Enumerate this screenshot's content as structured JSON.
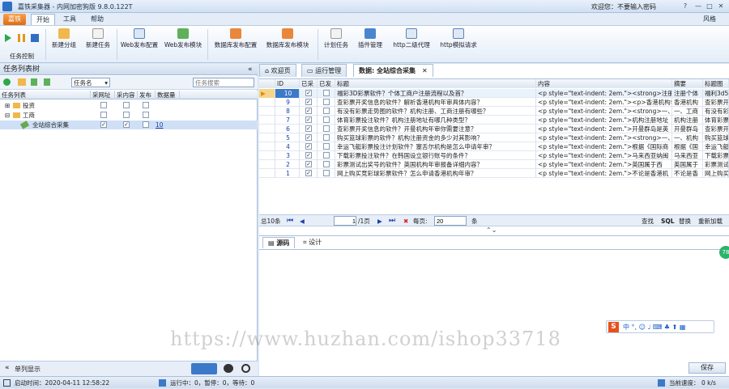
{
  "titlebar": {
    "title": "嘉铁采集器 - 内网加密狗版 9.8.0.122T",
    "welcome": "欢迎您：不要输入密码"
  },
  "menu": {
    "app": "嘉铁",
    "tabs": [
      "开始",
      "工具",
      "帮助"
    ],
    "right": "风格"
  },
  "ribbon": {
    "group_label": "任务控制",
    "buttons": [
      "新建分组",
      "新建任务",
      "Web发布配置",
      "Web发布模块",
      "数据库发布配置",
      "数据库发布模块",
      "计划任务",
      "插件管理",
      "http二级代理",
      "http模拟请求"
    ]
  },
  "left": {
    "title": "任务列表树",
    "filter_select": "任务名",
    "search_placeholder": "任务搜索",
    "columns": [
      "任务列表",
      "采网址",
      "采内容",
      "发布",
      "数据量"
    ],
    "tree": [
      {
        "name": "投资",
        "url": false,
        "content": false,
        "publish": false,
        "count": ""
      },
      {
        "name": "工商",
        "url": false,
        "content": false,
        "publish": false,
        "count": ""
      },
      {
        "name": "全站综合采集",
        "url": true,
        "content": true,
        "publish": false,
        "count": "10"
      }
    ],
    "bottom_label": "单列显示"
  },
  "right": {
    "tabs": [
      "欢迎页",
      "运行管理",
      "数据: 全站综合采集"
    ],
    "columns": [
      "ID",
      "已采",
      "已发",
      "标题",
      "内容",
      "摘要",
      "标题图"
    ],
    "rows": [
      {
        "id": "10",
        "c": true,
        "p": false,
        "title": "福彩3D彩票软件？个体工商户注册流程以及首？",
        "content": "<p style=\"text-indent: 2em.\"><strong>注册",
        "abs": "注册个体",
        "pic": "福利3d56"
      },
      {
        "id": "9",
        "c": true,
        "p": false,
        "title": "查彩票开奖信息的软件？解析香港机构年审具体内容？",
        "content": "<p style=\"text-indent: 2em.\"><p>香港机构年",
        "abs": "香港机构",
        "pic": "查彩票开"
      },
      {
        "id": "8",
        "c": true,
        "p": false,
        "title": "有没有彩票走势图的软件？机构注册、工商注册有哪些？",
        "content": "<p style=\"text-indent: 2em.\"><strong>一、工商",
        "abs": "一、工商",
        "pic": "有没有彩"
      },
      {
        "id": "7",
        "c": true,
        "p": false,
        "title": "体育彩票投注软件？机构注册地址有哪几种类型？",
        "content": "<p style=\"text-indent: 2em.\">机构注册地址",
        "abs": "机构注册",
        "pic": "体育彩票"
      },
      {
        "id": "6",
        "c": true,
        "p": false,
        "title": "查彩票开奖信息的软件？开曼机构年审你需要注意？",
        "content": "<p style=\"text-indent: 2em.\">开曼群岛是英",
        "abs": "开曼群岛",
        "pic": "查彩票开"
      },
      {
        "id": "5",
        "c": true,
        "p": false,
        "title": "购买篮球彩票的软件？机构注册资金的多少对其影响？",
        "content": "<p style=\"text-indent: 2em.\"><strong>一、",
        "abs": "一、机构",
        "pic": "购买篮球"
      },
      {
        "id": "4",
        "c": true,
        "p": false,
        "title": "幸运飞艇彩票投注计划软件？塞舌尔机构是怎么申请年审？",
        "content": "<p style=\"text-indent: 2em.\">根据《国际商",
        "abs": "根据《国",
        "pic": "幸运飞艇"
      },
      {
        "id": "3",
        "c": true,
        "p": false,
        "title": "下载彩票投注软件？在韩国设立银行账号的条件？",
        "content": "<p style=\"text-indent: 2em.\">马来西亚纳闽",
        "abs": "马来西亚",
        "pic": "下载彩票"
      },
      {
        "id": "2",
        "c": true,
        "p": false,
        "title": "彩票测试出奖号的软件？英国机构年审报备详细内容？",
        "content": "<p style=\"text-indent: 2em.\">英国属于西",
        "abs": "英国属于",
        "pic": "彩票测试"
      },
      {
        "id": "1",
        "c": true,
        "p": false,
        "title": "网上购买竞彩球彩票软件？怎么申请香港机构年审？",
        "content": "<p style=\"text-indent: 2em.\">不论是香港机",
        "abs": "不论是香",
        "pic": "网上购买"
      }
    ],
    "pager": {
      "total": "总10条",
      "page_value": "1",
      "page_suffix": "/1页",
      "per_page_label": "每页:",
      "per_page": "20",
      "unit": "条",
      "actions": [
        "查找",
        "SQL",
        "替换",
        "重新加载"
      ]
    },
    "subtabs": [
      "源码",
      "设计"
    ],
    "save": "保存"
  },
  "watermark": "https://www.huzhan.com/ishop33718",
  "status": {
    "start": "启动时间：2020-04-11 12:58:22",
    "run": "运行中：0，暂停：0，等待：0",
    "speed_label": "当前速度：",
    "speed": "0 k/s"
  },
  "colors": {
    "accent": "#2e6fc4",
    "orange": "#e06a12",
    "selection": "#cfe0f6"
  }
}
